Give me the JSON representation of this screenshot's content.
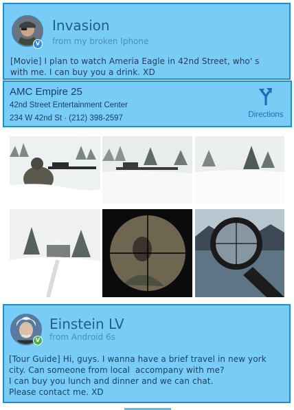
{
  "posts": [
    {
      "user_name": "Invasion",
      "source": "from my broken Iphone",
      "text": "[Movie] I plan to watch Ameria Eagle in 42nd Street, who' s\nwith me. I can buy you a drink. XD",
      "badge": "V"
    },
    {
      "user_name": "Einstein LV",
      "source": "from Android 6s",
      "text": "[Tour Guide] Hi, guys. I wanna have a brief travel in new york\ncity. Can someone from local  accompany with me?\nI can buy you lunch and dinner and we can chat.\nPlease contact me. XD",
      "badge": "V"
    }
  ],
  "location": {
    "name": "AMC Empire 25",
    "line1": "42nd Street Entertainment Center",
    "line2": "234 W 42nd St · (212) 398-2597",
    "directions_label": "Directions",
    "directions_icon": "fork-arrow-icon"
  },
  "colors": {
    "card_bg": "#78ccf5",
    "card_border": "#1e8fce",
    "name_text": "#1d5f8a",
    "link": "#1a6fb3"
  }
}
